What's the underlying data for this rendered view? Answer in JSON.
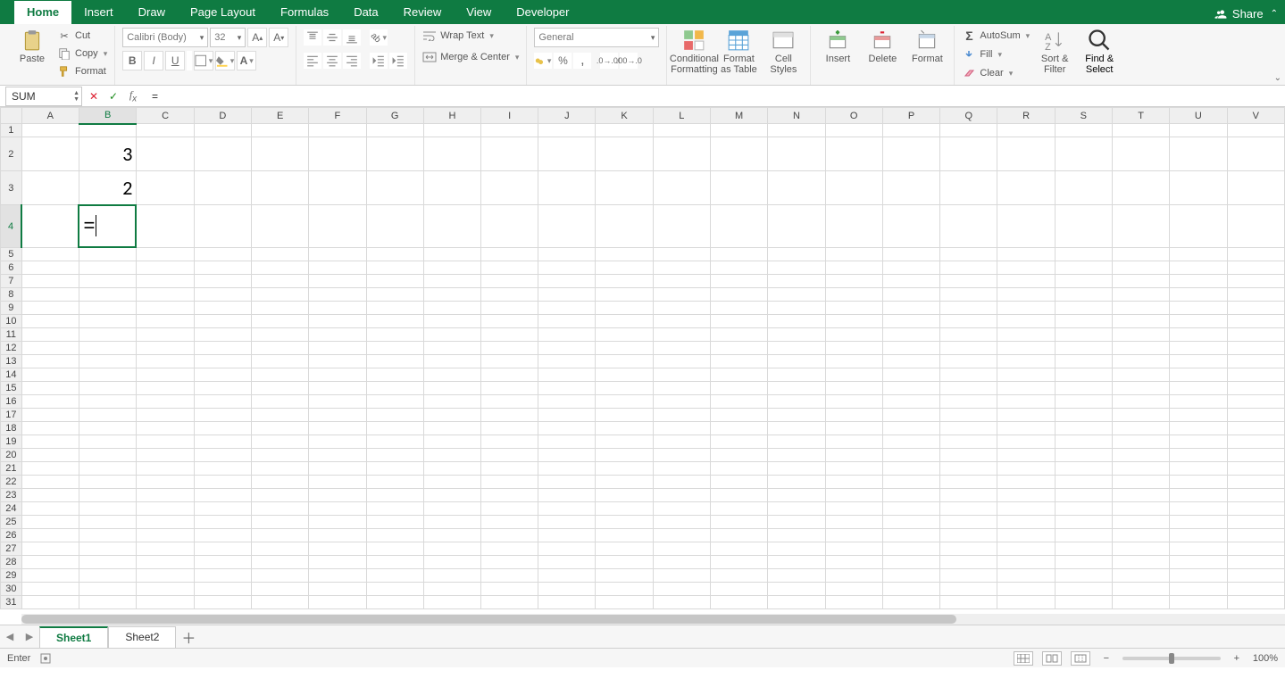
{
  "tabs": {
    "items": [
      "Home",
      "Insert",
      "Draw",
      "Page Layout",
      "Formulas",
      "Data",
      "Review",
      "View",
      "Developer"
    ],
    "active": "Home",
    "share": "Share"
  },
  "ribbon": {
    "clipboard": {
      "paste": "Paste",
      "cut": "Cut",
      "copy": "Copy",
      "format": "Format"
    },
    "font": {
      "name": "Calibri (Body)",
      "size": "32"
    },
    "align": {
      "wrap": "Wrap Text",
      "merge": "Merge & Center"
    },
    "number": {
      "format": "General"
    },
    "styles": {
      "cond": "Conditional\nFormatting",
      "table": "Format\nas Table",
      "cell": "Cell\nStyles"
    },
    "cells": {
      "insert": "Insert",
      "delete": "Delete",
      "format": "Format"
    },
    "editing": {
      "autosum": "AutoSum",
      "fill": "Fill",
      "clear": "Clear",
      "sort": "Sort &\nFilter",
      "find": "Find &\nSelect"
    }
  },
  "formula_bar": {
    "namebox": "SUM",
    "formula": "="
  },
  "grid": {
    "columns": [
      "A",
      "B",
      "C",
      "D",
      "E",
      "F",
      "G",
      "H",
      "I",
      "J",
      "K",
      "L",
      "M",
      "N",
      "O",
      "P",
      "Q",
      "R",
      "S",
      "T",
      "U",
      "V"
    ],
    "rows": 31,
    "active_col": "B",
    "active_row": 4,
    "data": {
      "B2": "3",
      "B3": "2"
    },
    "editing": {
      "ref": "B4",
      "value": "="
    }
  },
  "sheets": {
    "items": [
      "Sheet1",
      "Sheet2"
    ],
    "active": "Sheet1"
  },
  "status": {
    "mode": "Enter",
    "zoom": "100%"
  }
}
